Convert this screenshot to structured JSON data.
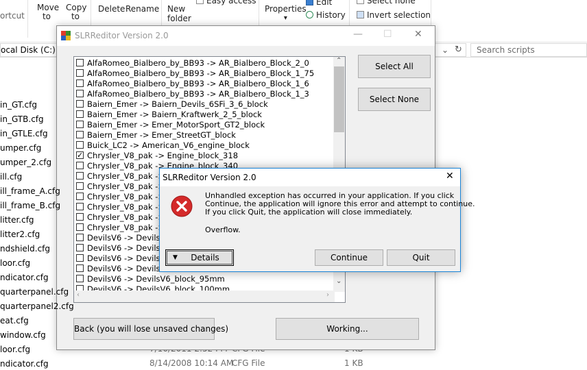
{
  "ribbon": {
    "shortcut": "ortcut",
    "move_to": "Move to",
    "copy_to": "Copy to",
    "delete": "Delete",
    "rename": "Rename",
    "new_folder_line1": "New",
    "new_folder_line2": "folder",
    "easy_access": "Easy access",
    "properties": "Properties",
    "edit": "Edit",
    "history": "History",
    "select_none": "Select none",
    "invert_selection": "Invert selection",
    "dropdown_arrow": "▾"
  },
  "address": {
    "path": "ocal Disk (C:)",
    "search_placeholder": "Search scripts"
  },
  "files": [
    "in_GT.cfg",
    "in_GTB.cfg",
    "in_GTLE.cfg",
    "umper.cfg",
    "umper_2.cfg",
    "ill.cfg",
    "ill_frame_A.cfg",
    "ill_frame_B.cfg",
    "litter.cfg",
    "litter2.cfg",
    "ndshield.cfg",
    "loor.cfg",
    "ndicator.cfg",
    "quarterpanel.cfg",
    "quarterpanel2.cfg",
    "eat.cfg",
    "window.cfg",
    "loor.cfg",
    "ndicator.cfg"
  ],
  "file_details": [
    {
      "date": "7/10/2011 2:52 PM",
      "type": "CFG File",
      "size": "1 KB"
    },
    {
      "date": "8/14/2008 10:14 AM",
      "type": "CFG File",
      "size": "1 KB"
    }
  ],
  "main_window": {
    "title": "SLRReditor Version 2.0",
    "minimize": "—",
    "maximize": "☐",
    "close": "✕",
    "select_all": "Select All",
    "select_none": "Select None",
    "back_button": "Back (you will lose unsaved changes)",
    "working_button": "Working...",
    "items": [
      {
        "label": "AlfaRomeo_Bialbero_by_BB93 -> AR_Bialbero_Block_2_0",
        "checked": false
      },
      {
        "label": "AlfaRomeo_Bialbero_by_BB93 -> AR_Bialbero_Block_1_75",
        "checked": false
      },
      {
        "label": "AlfaRomeo_Bialbero_by_BB93 -> AR_Bialbero_Block_1_6",
        "checked": false
      },
      {
        "label": "AlfaRomeo_Bialbero_by_BB93 -> AR_Bialbero_Block_1_3",
        "checked": false
      },
      {
        "label": "Baiern_Emer -> Baiern_Devils_6SFi_3_6_block",
        "checked": false
      },
      {
        "label": "Baiern_Emer -> Baiern_Kraftwerk_2_5_block",
        "checked": false
      },
      {
        "label": "Baiern_Emer -> Emer_MotorSport_GT2_block",
        "checked": false
      },
      {
        "label": "Baiern_Emer -> Emer_StreetGT_block",
        "checked": false
      },
      {
        "label": "Buick_LC2 -> American_V6_engine_block",
        "checked": false
      },
      {
        "label": "Chrysler_V8_pak -> Engine_block_318",
        "checked": true
      },
      {
        "label": "Chrysler_V8_pak -> Engine_block_340",
        "checked": false
      },
      {
        "label": "Chrysler_V8_pak -> E",
        "checked": false
      },
      {
        "label": "Chrysler_V8_pak -> E",
        "checked": false
      },
      {
        "label": "Chrysler_V8_pak -> E",
        "checked": false
      },
      {
        "label": "Chrysler_V8_pak -> E",
        "checked": false
      },
      {
        "label": "Chrysler_V8_pak -> E",
        "checked": false
      },
      {
        "label": "Chrysler_V8_pak -> E",
        "checked": false
      },
      {
        "label": "DevilsV6 -> DevilsV6",
        "checked": false
      },
      {
        "label": "DevilsV6 -> DevilsV6",
        "checked": false
      },
      {
        "label": "DevilsV6 -> DevilsV6",
        "checked": false
      },
      {
        "label": "DevilsV6 -> DevilsV6",
        "checked": false
      },
      {
        "label": "DevilsV6 -> DevilsV6_block_95mm",
        "checked": false
      },
      {
        "label": "DevilsV6 -> DevilsV6_block_100mm",
        "checked": false
      }
    ]
  },
  "error_dialog": {
    "title": "SLRReditor Version 2.0",
    "close": "✕",
    "message_line1": "Unhandled exception has occurred in your application. If you click",
    "message_line2": "Continue, the application will ignore this error and attempt to continue.",
    "message_line3": "If you click Quit, the application will close immediately.",
    "detail": "Overflow.",
    "details_button": "Details",
    "continue_button": "Continue",
    "quit_button": "Quit"
  },
  "colors": {
    "dialog_border": "#1883d7",
    "error_icon_red": "#d42a2a",
    "window_bg": "#f0f0f0"
  }
}
